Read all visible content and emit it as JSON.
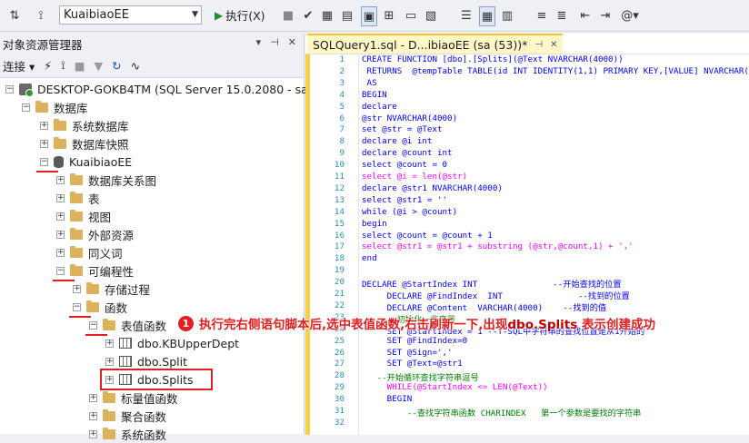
{
  "toolbar": {
    "database": "KuaibiaoEE",
    "execute_label": "执行(X)"
  },
  "object_explorer": {
    "title": "对象资源管理器",
    "connect_label": "连接",
    "nodes": [
      {
        "label": "DESKTOP-GOKB4TM (SQL Server 15.0.2080 - sa)"
      },
      {
        "label": "数据库"
      },
      {
        "label": "系统数据库"
      },
      {
        "label": "数据库快照"
      },
      {
        "label": "KuaibiaoEE"
      },
      {
        "label": "数据库关系图"
      },
      {
        "label": "表"
      },
      {
        "label": "视图"
      },
      {
        "label": "外部资源"
      },
      {
        "label": "同义词"
      },
      {
        "label": "可编程性"
      },
      {
        "label": "存储过程"
      },
      {
        "label": "函数"
      },
      {
        "label": "表值函数"
      },
      {
        "label": "dbo.KBUpperDept"
      },
      {
        "label": "dbo.Split"
      },
      {
        "label": "dbo.Splits"
      },
      {
        "label": "标量值函数"
      },
      {
        "label": "聚合函数"
      },
      {
        "label": "系统函数"
      }
    ]
  },
  "editor": {
    "tab_title": "SQLQuery1.sql - D...ibiaoEE (sa (53))*",
    "line_numbers": [
      "1",
      "2",
      "3",
      "4",
      "5",
      "6",
      "7",
      "8",
      "9",
      "10",
      "11",
      "12",
      "13",
      "14",
      "15",
      "16",
      "17",
      "18",
      "19",
      "20",
      "21",
      "22",
      "23",
      "24",
      "25",
      "26",
      "27",
      "28",
      "29",
      "30",
      "31",
      "32"
    ],
    "lines": [
      "CREATE FUNCTION [dbo].[Splits](@Text NVARCHAR(4000))",
      " RETURNS  @tempTable TABLE(id INT IDENTITY(1,1) PRIMARY KEY,[VALUE] NVARCHAR(4000))",
      " AS",
      "BEGIN",
      "declare",
      "@str NVARCHAR(4000)",
      "set @str = @Text",
      "declare @i int",
      "declare @count int",
      "select @count = 0",
      "select @i = len(@str)",
      "declare @str1 NVARCHAR(4000)",
      "select @str1 = ''",
      "while (@i > @count)",
      "begin",
      "select @count = @count + 1",
      "select @str1 = @str1 + substring (@str,@count,1) + ','",
      "end",
      "",
      "DECLARE @StartIndex INT               --开始查找的位置",
      "     DECLARE @FindIndex  INT               --找到的位置",
      "     DECLARE @Content  VARCHAR(4000)    --找到的值",
      "     --初始化一些变量",
      "     SET @StartIndex = 1 --T-SQL中字符串的查找位置是从1开始的",
      "     SET @FindIndex=0",
      "     SET @Sign=','",
      "     SET @Text=@str1",
      "   --开始循环查找字符串逗号",
      "     WHILE(@StartIndex <= LEN(@Text))",
      "     BEGIN",
      "         --查找字符串函数 CHARINDEX   第一个参数是要找的字符串",
      ""
    ]
  },
  "annotation": {
    "number": "1",
    "text_before": "执行完右侧语句脚本后,选中表值函数,右击刷新一下,出现",
    "highlight": "dbo.Splits",
    "text_after": " 表示创建成功"
  }
}
